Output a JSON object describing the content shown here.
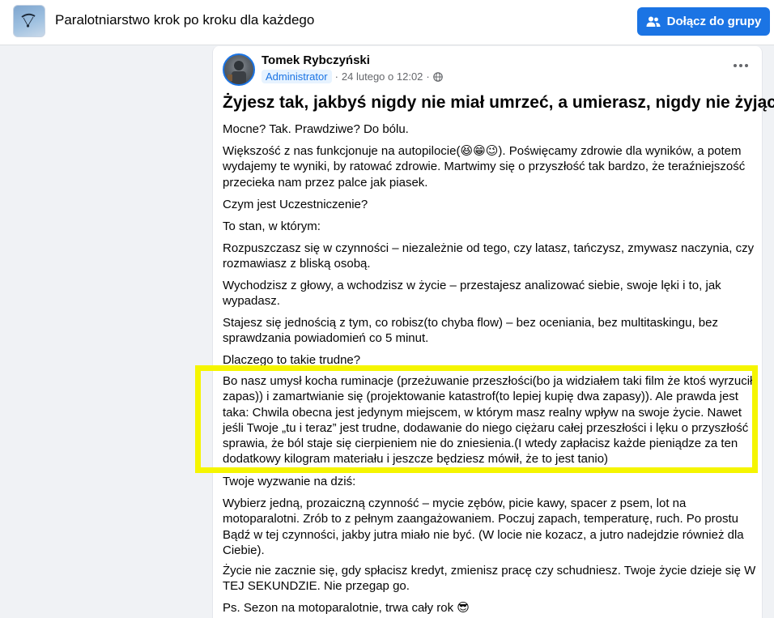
{
  "header": {
    "group_title": "Paralotniarstwo krok po kroku dla każdego",
    "join_label": "Dołącz do grupy",
    "join_icon": "group-add-icon",
    "thumb_icon": "paraglider-thumbnail"
  },
  "post": {
    "author": "Tomek Rybczyński",
    "role": "Administrator",
    "date": "24 lutego o 12:02",
    "separator": "·",
    "privacy_icon": "globe-icon",
    "more_icon": "more-options-icon",
    "title": "Żyjesz tak, jakbyś nigdy nie miał umrzeć, a umierasz, nigdy nie żyjąc?",
    "paragraphs": [
      "Mocne? Tak. Prawdziwe? Do bólu.",
      "Większość z nas funkcjonuje na autopilocie(😆😁😉). Poświęcamy zdrowie dla wyników, a potem wydajemy te wyniki, by ratować zdrowie. Martwimy się o przyszłość tak bardzo, że teraźniejszość przecieka nam przez palce jak piasek.",
      "Czym jest Uczestniczenie?",
      "To stan, w którym:",
      "Rozpuszczasz się w czynności – niezależnie od tego, czy latasz, tańczysz, zmywasz naczynia, czy rozmawiasz z bliską osobą.",
      "Wychodzisz z głowy, a wchodzisz w życie – przestajesz analizować siebie, swoje lęki i to, jak wypadasz.",
      "Stajesz się jednością z tym, co robisz(to chyba flow) – bez oceniania, bez multitaskingu, bez sprawdzania powiadomień co 5 minut.",
      "Dlaczego to takie trudne?",
      "Bo nasz umysł kocha ruminacje (przeżuwanie przeszłości(bo ja widziałem taki film że ktoś wyrzucił zapas)) i zamartwianie się (projektowanie katastrof(to lepiej kupię dwa zapasy)). Ale prawda jest taka: Chwila obecna jest jedynym miejscem, w którym masz realny wpływ na swoje życie. Nawet jeśli Twoje „tu i teraz” jest trudne, dodawanie do niego ciężaru całej przeszłości i lęku o przyszłość sprawia, że ból staje się cierpieniem nie do zniesienia.(I wtedy zapłacisz każde pieniądze za ten dodatkowy kilogram materiału i jeszcze będziesz mówił, że to jest tanio)",
      "Twoje wyzwanie na dziś:",
      "Wybierz jedną, prozaiczną czynność – mycie zębów, picie kawy, spacer z psem, lot na motoparalotni. Zrób to z pełnym zaangażowaniem. Poczuj zapach, temperaturę, ruch. Po prostu Bądź w tej czynności, jakby jutra miało nie być. (W locie nie kozacz, a jutro nadejdzie również dla Ciebie).",
      "Życie nie zacznie się, gdy spłacisz kredyt, zmienisz pracę czy schudniesz. Twoje życie dzieje się W TEJ SEKUNDZIE. Nie przegap go.",
      "Ps. Sezon na motoparalotnie, trwa cały rok 😎"
    ]
  },
  "colors": {
    "accent": "#1b74e4",
    "highlight_frame": "#f5f500",
    "page_bg": "#f0f2f5",
    "secondary_text": "#65676b"
  }
}
